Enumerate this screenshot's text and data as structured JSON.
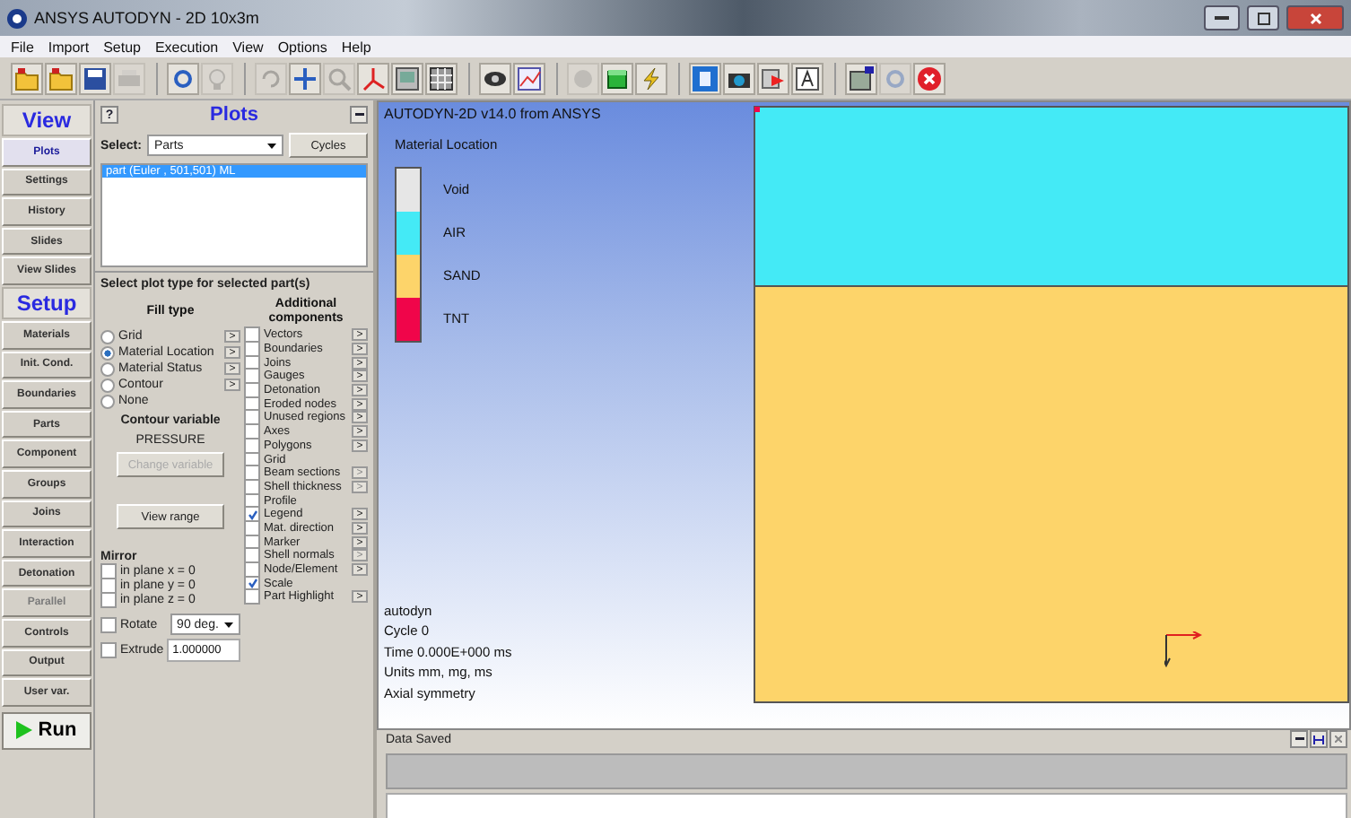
{
  "window": {
    "title": "ANSYS AUTODYN - 2D 10x3m"
  },
  "menu": [
    "File",
    "Import",
    "Setup",
    "Execution",
    "View",
    "Options",
    "Help"
  ],
  "toolbar_groups": [
    {
      "buttons": [
        {
          "kind": "folder",
          "disabled": false
        },
        {
          "kind": "folder",
          "disabled": false
        },
        {
          "kind": "save",
          "disabled": false
        },
        {
          "kind": "printer",
          "disabled": true
        }
      ]
    },
    {
      "buttons": [
        {
          "kind": "refresh",
          "disabled": false
        },
        {
          "kind": "bulb",
          "disabled": true
        }
      ]
    },
    {
      "buttons": [
        {
          "kind": "rotate",
          "disabled": true
        },
        {
          "kind": "move",
          "disabled": false
        },
        {
          "kind": "zoom",
          "disabled": true
        },
        {
          "kind": "axes",
          "disabled": false
        },
        {
          "kind": "image",
          "disabled": false
        },
        {
          "kind": "grid",
          "disabled": false
        }
      ]
    },
    {
      "buttons": [
        {
          "kind": "eye",
          "disabled": false
        },
        {
          "kind": "chart",
          "disabled": false
        }
      ]
    },
    {
      "buttons": [
        {
          "kind": "circle",
          "disabled": true
        },
        {
          "kind": "cube",
          "disabled": false
        },
        {
          "kind": "lightning",
          "disabled": false
        }
      ]
    },
    {
      "buttons": [
        {
          "kind": "square",
          "disabled": false
        },
        {
          "kind": "camera",
          "disabled": false
        },
        {
          "kind": "film",
          "disabled": false
        },
        {
          "kind": "letter",
          "disabled": false
        }
      ]
    },
    {
      "buttons": [
        {
          "kind": "window",
          "disabled": false
        },
        {
          "kind": "refresh",
          "disabled": true
        },
        {
          "kind": "close",
          "disabled": false
        }
      ]
    }
  ],
  "nav": [
    {
      "kind": "header",
      "label": "View"
    },
    {
      "kind": "button",
      "label": "Plots",
      "selected": true,
      "disabled": false
    },
    {
      "kind": "button",
      "label": "Settings",
      "selected": false,
      "disabled": false
    },
    {
      "kind": "button",
      "label": "History",
      "selected": false,
      "disabled": false
    },
    {
      "kind": "button",
      "label": "Slides",
      "selected": false,
      "disabled": false
    },
    {
      "kind": "button",
      "label": "View Slides",
      "selected": false,
      "disabled": false
    },
    {
      "kind": "header",
      "label": "Setup"
    },
    {
      "kind": "button",
      "label": "Materials",
      "selected": false,
      "disabled": false
    },
    {
      "kind": "button",
      "label": "Init. Cond.",
      "selected": false,
      "disabled": false
    },
    {
      "kind": "button",
      "label": "Boundaries",
      "selected": false,
      "disabled": false
    },
    {
      "kind": "button",
      "label": "Parts",
      "selected": false,
      "disabled": false
    },
    {
      "kind": "button",
      "label": "Component",
      "selected": false,
      "disabled": false
    },
    {
      "kind": "button",
      "label": "Groups",
      "selected": false,
      "disabled": false
    },
    {
      "kind": "button",
      "label": "Joins",
      "selected": false,
      "disabled": false
    },
    {
      "kind": "button",
      "label": "Interaction",
      "selected": false,
      "disabled": false
    },
    {
      "kind": "button",
      "label": "Detonation",
      "selected": false,
      "disabled": false
    },
    {
      "kind": "button",
      "label": "Parallel",
      "selected": false,
      "disabled": true
    },
    {
      "kind": "button",
      "label": "Controls",
      "selected": false,
      "disabled": false
    },
    {
      "kind": "button",
      "label": "Output",
      "selected": false,
      "disabled": false
    },
    {
      "kind": "button",
      "label": "User var.",
      "selected": false,
      "disabled": false
    },
    {
      "kind": "run",
      "label": "Run"
    }
  ],
  "plots_panel": {
    "help": "?",
    "title": "Plots",
    "select_label": "Select:",
    "select_value": "Parts",
    "cycles_button": "Cycles",
    "parts": [
      {
        "label": "part (Euler , 501,501) ML",
        "selected": true
      }
    ],
    "group_title": "Select plot type for selected part(s)",
    "fill_type": {
      "title": "Fill type",
      "options": [
        {
          "label": "Grid",
          "selected": false,
          "button": ">"
        },
        {
          "label": "Material Location",
          "selected": true,
          "button": ">"
        },
        {
          "label": "Material Status",
          "selected": false,
          "button": ">"
        },
        {
          "label": "Contour",
          "selected": false,
          "button": ">"
        },
        {
          "label": "None",
          "selected": false
        }
      ]
    },
    "contour_title": "Contour variable",
    "contour_value": "PRESSURE",
    "change_button": {
      "label": "Change variable",
      "disabled": true
    },
    "view_range_button": "View range",
    "mirror": {
      "title": "Mirror",
      "options": [
        {
          "label": "in plane x = 0",
          "checked": false
        },
        {
          "label": "in plane y = 0",
          "checked": false
        },
        {
          "label": "in plane z = 0",
          "checked": false
        }
      ]
    },
    "rotate": {
      "label": "Rotate",
      "checked": false,
      "value": "90 deg."
    },
    "extrude": {
      "label": "Extrude",
      "checked": false,
      "value": "1.000000"
    },
    "additional": {
      "title": "Additional components",
      "items": [
        {
          "label": "Vectors",
          "checked": false,
          "button": ">",
          "button_disabled": false
        },
        {
          "label": "Boundaries",
          "checked": false,
          "button": ">",
          "button_disabled": false
        },
        {
          "label": "Joins",
          "checked": false,
          "button": ">",
          "button_disabled": false
        },
        {
          "label": "Gauges",
          "checked": false,
          "button": ">",
          "button_disabled": false
        },
        {
          "label": "Detonation",
          "checked": false,
          "button": ">",
          "button_disabled": false
        },
        {
          "label": "Eroded nodes",
          "checked": false,
          "button": ">",
          "button_disabled": false
        },
        {
          "label": "Unused regions",
          "checked": false,
          "button": ">",
          "button_disabled": false
        },
        {
          "label": "Axes",
          "checked": false,
          "button": ">",
          "button_disabled": false
        },
        {
          "label": "Polygons",
          "checked": false,
          "button": ">",
          "button_disabled": false
        },
        {
          "label": "Grid",
          "checked": false
        },
        {
          "label": "Beam sections",
          "checked": false,
          "button": ">",
          "button_disabled": true
        },
        {
          "label": "Shell thickness",
          "checked": false,
          "button": ">",
          "button_disabled": true
        },
        {
          "label": "Profile",
          "checked": false
        },
        {
          "label": "Legend",
          "checked": true,
          "button": ">",
          "button_disabled": false
        },
        {
          "label": "Mat. direction",
          "checked": false,
          "button": ">",
          "button_disabled": false
        },
        {
          "label": "Marker",
          "checked": false,
          "button": ">",
          "button_disabled": false
        },
        {
          "label": "Shell normals",
          "checked": false,
          "button": ">",
          "button_disabled": true
        },
        {
          "label": "Node/Element",
          "checked": false,
          "button": ">",
          "button_disabled": false
        },
        {
          "label": "Scale",
          "checked": true
        },
        {
          "label": "Part Highlight",
          "checked": false,
          "button": ">",
          "button_disabled": false
        }
      ]
    }
  },
  "viewport": {
    "title": "AUTODYN-2D v14.0 from ANSYS",
    "legend_title": "Material Location",
    "materials": [
      {
        "name": "Void",
        "color": "#e6e6e6"
      },
      {
        "name": "AIR",
        "color": "#44eaf6"
      },
      {
        "name": "SAND",
        "color": "#fdd46a"
      },
      {
        "name": "TNT",
        "color": "#f0054a"
      }
    ],
    "info": [
      "autodyn",
      "Cycle 0",
      "Time 0.000E+000 ms",
      "Units mm, mg, ms",
      "Axial symmetry"
    ]
  },
  "log_panel": {
    "title": "Data Saved"
  }
}
